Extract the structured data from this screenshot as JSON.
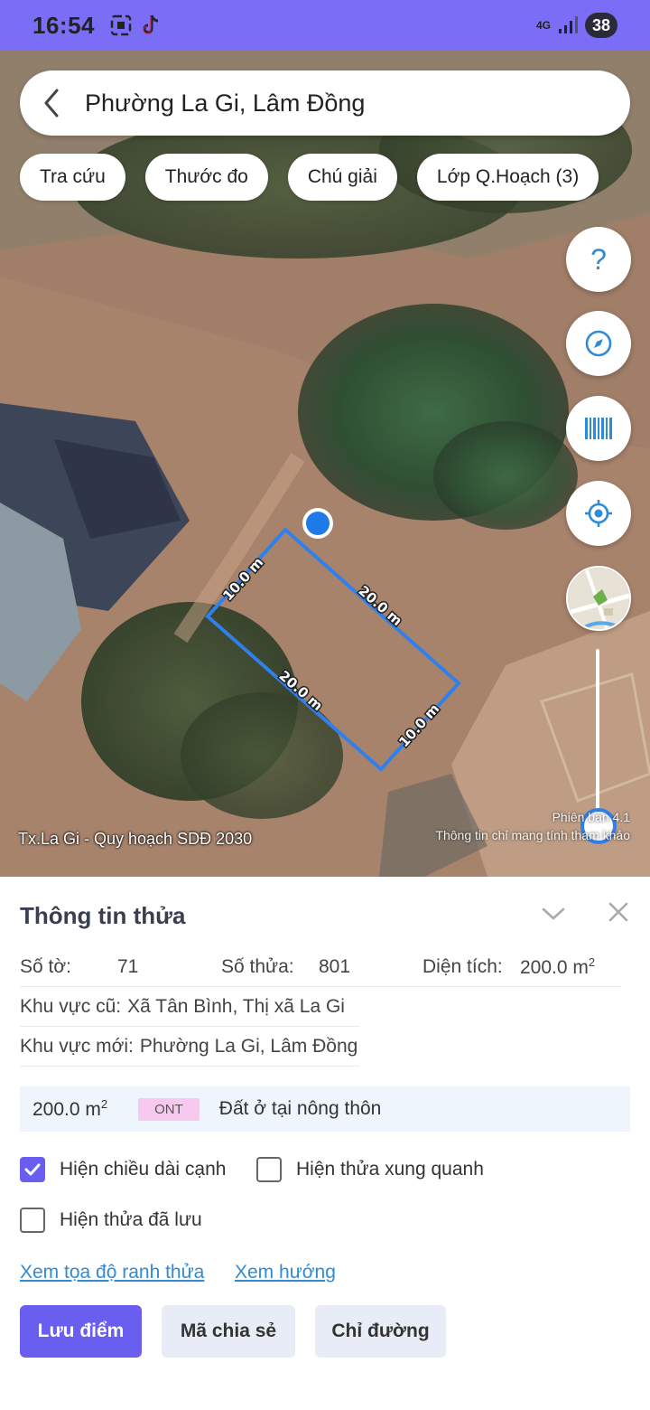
{
  "status_bar": {
    "time": "16:54",
    "network": "4G",
    "battery": "38"
  },
  "search": {
    "location": "Phường La Gi, Lâm Đồng"
  },
  "chips": [
    {
      "label": "Tra cứu"
    },
    {
      "label": "Thước đo"
    },
    {
      "label": "Chú giải"
    },
    {
      "label": "Lớp Q.Hoạch (3)"
    }
  ],
  "map": {
    "caption": "Tx.La Gi - Quy hoạch SDĐ 2030",
    "version_note": "Phiên bản 4.1",
    "disclaimer": "Thông tin chỉ mang tính tham khảo",
    "edges": [
      "10.0 m",
      "20.0 m",
      "20.0 m",
      "10.0 m"
    ]
  },
  "panel": {
    "title": "Thông tin thửa",
    "sheet_label": "Số tờ:",
    "sheet_value": "71",
    "parcel_label": "Số thửa:",
    "parcel_value": "801",
    "area_label": "Diện tích:",
    "area_value": "200.0 m",
    "area_unit_sup": "2",
    "old_area_label": "Khu vực cũ:",
    "old_area_value": "Xã Tân Bình, Thị xã La Gi",
    "new_area_label": "Khu vực mới:",
    "new_area_value": "Phường La Gi, Lâm Đồng",
    "landuse_area": "200.0 m",
    "landuse_area_sup": "2",
    "landuse_code": "ONT",
    "landuse_name": "Đất ở tại nông thôn",
    "options": {
      "show_edge_length": "Hiện chiều dài cạnh",
      "show_edge_length_checked": true,
      "show_neighbors": "Hiện thửa xung quanh",
      "show_neighbors_checked": false,
      "show_saved": "Hiện thửa đã lưu",
      "show_saved_checked": false
    },
    "links": {
      "coords": "Xem tọa độ ranh thửa",
      "direction": "Xem hướng"
    },
    "buttons": {
      "save": "Lưu điểm",
      "share": "Mã chia sẻ",
      "directions": "Chỉ đường"
    }
  },
  "colors": {
    "accent": "#6a5ef0",
    "status_bar": "#7b6ef6",
    "parcel_outline": "#2f80ed",
    "link": "#2f8bd6",
    "ont_badge": "#f8c9ee"
  }
}
